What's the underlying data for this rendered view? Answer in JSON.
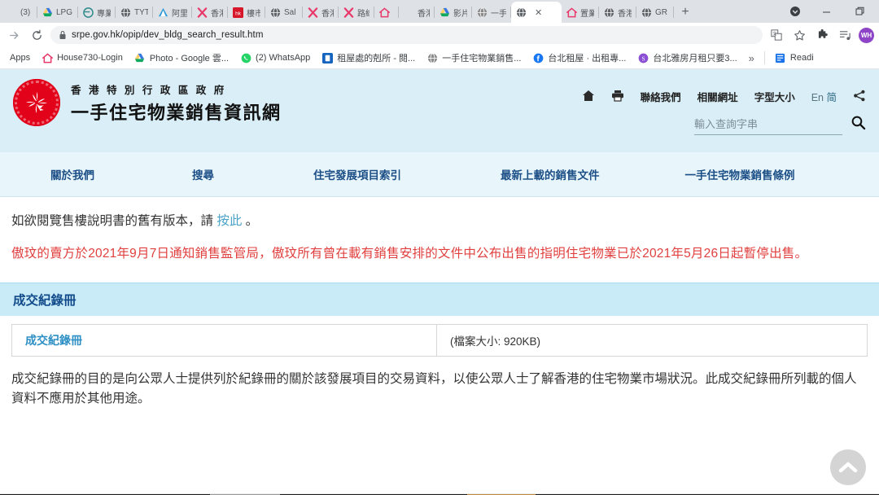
{
  "browser": {
    "tabs": [
      {
        "label": "(3)",
        "icon": "text-tab",
        "active": false
      },
      {
        "label": "LPG",
        "icon": "drive-icon",
        "active": false
      },
      {
        "label": "專業",
        "icon": "euro-icon",
        "active": false
      },
      {
        "label": "TYT",
        "icon": "globe-icon",
        "active": false
      },
      {
        "label": "阿里",
        "icon": "triangle-icon",
        "active": false
      },
      {
        "label": "香港",
        "icon": "x-icon",
        "active": false
      },
      {
        "label": "樓市",
        "icon": "hket-icon",
        "active": false
      },
      {
        "label": "Sal",
        "icon": "globe-icon",
        "active": false
      },
      {
        "label": "香港",
        "icon": "x-icon",
        "active": false
      },
      {
        "label": "路線",
        "icon": "x-icon",
        "active": false
      },
      {
        "label": "",
        "icon": "house730-icon",
        "active": false
      },
      {
        "label": "香港",
        "icon": "text-tab",
        "active": false
      },
      {
        "label": "影片",
        "icon": "drive-icon",
        "active": false
      },
      {
        "label": "一手",
        "icon": "globe-gray-icon",
        "active": false
      },
      {
        "label": "",
        "icon": "globe-icon",
        "active": true
      },
      {
        "label": "置業",
        "icon": "house730-icon",
        "active": false
      },
      {
        "label": "香港",
        "icon": "globe-icon",
        "active": false
      },
      {
        "label": "GR",
        "icon": "globe-icon",
        "active": false
      }
    ],
    "new_tab_label": "+",
    "window_controls": {
      "minimize": "–",
      "maximize": "❐",
      "menu_dot": "●"
    },
    "toolbar": {
      "back_icon": "back-arrow-icon",
      "forward_icon": "forward-arrow-icon",
      "reload_icon": "reload-icon",
      "lock_icon": "lock-icon",
      "url": "srpe.gov.hk/opip/dev_bldg_search_result.htm",
      "translate_icon": "translate-icon",
      "bookmark_icon": "star-icon",
      "extensions_icon": "puzzle-icon",
      "media_icon": "media-list-icon",
      "avatar_initials": "WH",
      "avatar_color": "#8e44c7"
    },
    "bookmarks": {
      "apps_label": "Apps",
      "items": [
        {
          "label": "House730-Login",
          "icon": "house730-icon"
        },
        {
          "label": "Photo - Google 雲...",
          "icon": "drive-icon"
        },
        {
          "label": "(2) WhatsApp",
          "icon": "whatsapp-icon"
        },
        {
          "label": "租屋處的剋所 - 閱...",
          "icon": "blue-icon"
        },
        {
          "label": "一手住宅物業銷售...",
          "icon": "globe-gray-icon"
        },
        {
          "label": "台北租屋 · 出租專...",
          "icon": "facebook-icon"
        },
        {
          "label": "台北雅房月租只要3...",
          "icon": "purple-icon"
        }
      ],
      "overflow_label": "»",
      "reading_list_label": "Readi",
      "reading_list_icon": "reading-list-icon"
    }
  },
  "site": {
    "org_line": "香 港 特 別 行 政 區 政 府",
    "site_title": "一手住宅物業銷售資訊網",
    "logo_name": "hksar-bauhinia-emblem",
    "utility_nav": [
      {
        "label": "",
        "icon": "home-icon"
      },
      {
        "label": "",
        "icon": "print-icon"
      },
      {
        "label": "聯絡我們",
        "icon": ""
      },
      {
        "label": "相關網址",
        "icon": ""
      },
      {
        "label": "字型大小",
        "icon": ""
      }
    ],
    "lang_en": "En",
    "lang_cn": "简",
    "share_icon": "share-icon",
    "search": {
      "placeholder": "輸入查詢字串",
      "value": "",
      "icon": "search-icon"
    },
    "main_nav": [
      {
        "label": "關於我們"
      },
      {
        "label": "搜尋"
      },
      {
        "label": "住宅發展項目索引"
      },
      {
        "label": "最新上載的銷售文件"
      },
      {
        "label": "一手住宅物業銷售條例"
      }
    ]
  },
  "content": {
    "notice_prefix": "如欲閱覽售樓說明書的舊有版本，請 ",
    "notice_link": "按此",
    "notice_suffix": " 。",
    "red_notice": "傲玟的賣方於2021年9月7日通知銷售監管局，傲玟所有曾在載有銷售安排的文件中公布出售的指明住宅物業已於2021年5月26日起暫停出售。",
    "section_title": "成交紀錄冊",
    "table": {
      "doc_link": "成交紀錄冊",
      "file_size": "(檔案大小: 920KB)"
    },
    "closing_text": "成交紀錄冊的目的是向公眾人士提供列於紀錄冊的關於該發展項目的交易資料，以使公眾人士了解香港的住宅物業市場狀況。此成交紀錄冊所列載的個人資料不應用於其他用途。",
    "scroll_top_icon": "chevron-up-icon"
  },
  "colors": {
    "header_bg": "#d9eef6",
    "nav_bg": "#e8f5fb",
    "section_bg": "#c9ebf7",
    "link_blue": "#2d8fc4",
    "nav_blue": "#1c4f86",
    "alert_red": "#e0403f"
  }
}
